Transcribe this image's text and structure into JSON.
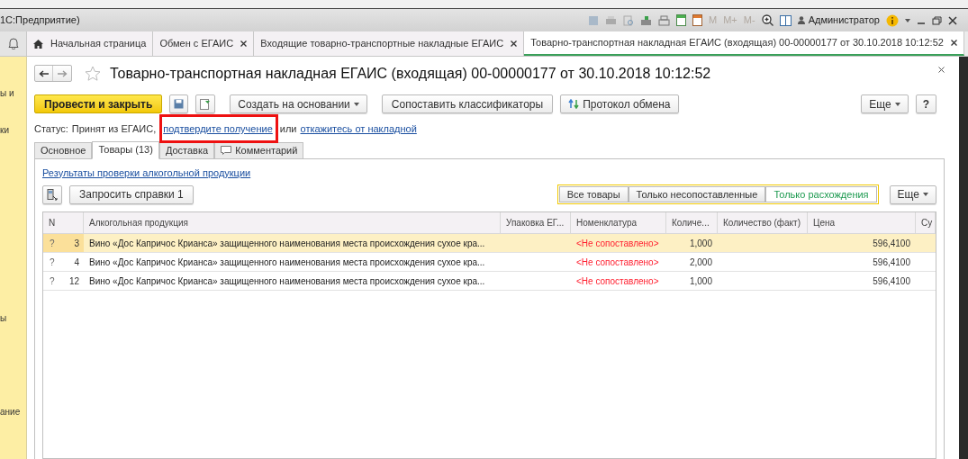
{
  "app_title": "1С:Предприятие)",
  "toolbar": {
    "memory_buttons": [
      "M",
      "M+",
      "M-"
    ],
    "user": "Администратор"
  },
  "sidebar_fragments": [
    "ы и",
    "ки",
    "ы",
    "ание"
  ],
  "tabs": [
    {
      "label": "Начальная страница",
      "kind": "home",
      "selected": false
    },
    {
      "label": "Обмен с ЕГАИС",
      "kind": "closable",
      "selected": false
    },
    {
      "label": "Входящие товарно-транспортные накладные ЕГАИС",
      "kind": "closable",
      "selected": false
    },
    {
      "label": "Товарно-транспортная накладная ЕГАИС (входящая) 00-00000177 от 30.10.2018 10:12:52",
      "kind": "closable",
      "selected": true
    }
  ],
  "form": {
    "title": "Товарно-транспортная накладная ЕГАИС (входящая) 00-00000177 от 30.10.2018 10:12:52",
    "buttons": {
      "post_close": "Провести и закрыть",
      "create_based": "Создать на основании",
      "match": "Сопоставить классификаторы",
      "protocol": "Протокол обмена",
      "more": "Еще",
      "help": "?"
    },
    "status": {
      "label": "Статус:",
      "value": "Принят из ЕГАИС,",
      "link1": "подтвердите получение",
      "middle": "или",
      "link2": "откажитесь от накладной"
    },
    "subtabs": [
      {
        "label": "Основное",
        "selected": false,
        "icon": false
      },
      {
        "label": "Товары (13)",
        "selected": true,
        "icon": false
      },
      {
        "label": "Доставка",
        "selected": false,
        "icon": false
      },
      {
        "label": "Комментарий",
        "selected": false,
        "icon": true
      }
    ],
    "check_link": "Результаты проверки алкогольной продукции",
    "request_button": "Запросить справки 1",
    "filters": [
      {
        "label": "Все товары",
        "selected": false
      },
      {
        "label": "Только несопоставленные",
        "selected": false
      },
      {
        "label": "Только расхождения",
        "selected": true
      }
    ],
    "filter_more": "Еще",
    "table": {
      "columns": [
        "N",
        "Алкогольная продукция",
        "Упаковка ЕГ...",
        "Номенклатура",
        "Количе...",
        "Количество (факт)",
        "Цена",
        "Су"
      ],
      "rows": [
        {
          "selected": true,
          "mark": "?",
          "n": "3",
          "product": "Вино «Дос Капричос Крианса» защищенного наименования места происхождения сухое кра...",
          "nomenclature": "<Не сопоставлено>",
          "qty": "1,000",
          "price": "596,4100"
        },
        {
          "selected": false,
          "mark": "?",
          "n": "4",
          "product": "Вино «Дос Капричос Крианса» защищенного наименования места происхождения сухое кра...",
          "nomenclature": "<Не сопоставлено>",
          "qty": "2,000",
          "price": "596,4100"
        },
        {
          "selected": false,
          "mark": "?",
          "n": "12",
          "product": "Вино «Дос Капричос Крианса» защищенного наименования места происхождения сухое кра...",
          "nomenclature": "<Не сопоставлено>",
          "qty": "1,000",
          "price": "596,4100"
        }
      ]
    }
  }
}
